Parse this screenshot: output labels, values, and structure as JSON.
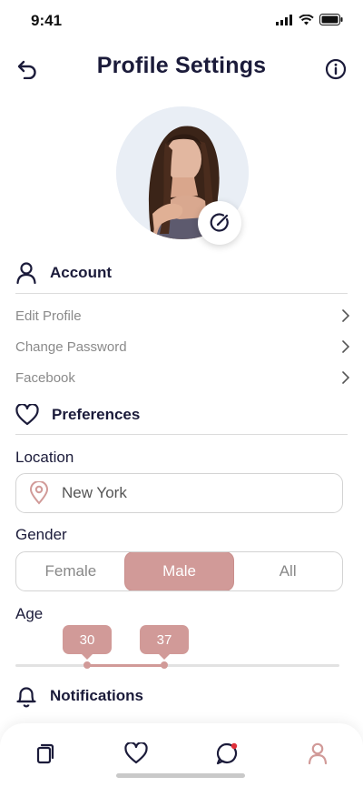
{
  "status_bar": {
    "time": "9:41"
  },
  "header": {
    "title": "Profile Settings"
  },
  "account": {
    "title": "Account",
    "items": [
      {
        "label": "Edit Profile"
      },
      {
        "label": "Change Password"
      },
      {
        "label": "Facebook"
      }
    ]
  },
  "preferences": {
    "title": "Preferences",
    "location_label": "Location",
    "location_value": "New York",
    "gender_label": "Gender",
    "gender_options": [
      "Female",
      "Male",
      "All"
    ],
    "gender_selected": "Male",
    "age_label": "Age",
    "age_min": "30",
    "age_max": "37"
  },
  "notifications": {
    "title": "Notifications"
  },
  "colors": {
    "accent": "#d19a98",
    "title": "#1b1b3a",
    "muted": "#8a8a8a"
  },
  "icons": [
    "back-icon",
    "info-icon",
    "edit-photo-icon",
    "user-icon",
    "heart-icon",
    "location-pin-icon",
    "bell-icon",
    "cards-icon",
    "chat-icon",
    "profile-icon"
  ]
}
